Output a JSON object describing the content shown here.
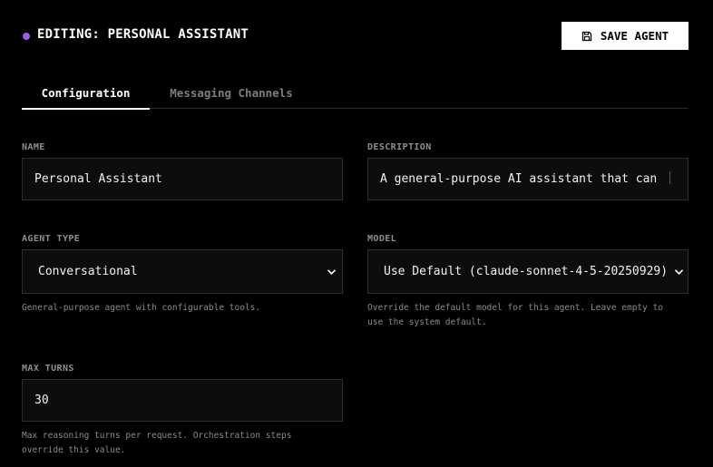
{
  "header": {
    "title": "EDITING: PERSONAL ASSISTANT",
    "save_label": "SAVE AGENT",
    "accent": "#9b5cf0"
  },
  "tabs": [
    {
      "label": "Configuration",
      "active": true
    },
    {
      "label": "Messaging Channels",
      "active": false
    }
  ],
  "form": {
    "name": {
      "label": "NAME",
      "value": "Personal Assistant"
    },
    "description": {
      "label": "DESCRIPTION",
      "value": "A general-purpose AI assistant that can"
    },
    "agent_type": {
      "label": "AGENT TYPE",
      "value": "Conversational",
      "help": "General-purpose agent with configurable tools."
    },
    "model": {
      "label": "MODEL",
      "value": "Use Default (claude-sonnet-4-5-20250929)",
      "help_line1": "Override the default model for this agent. Leave empty to",
      "help_line2": "use the system default."
    },
    "max_turns": {
      "label": "MAX TURNS",
      "value": "30",
      "help_line1": "Max reasoning turns per request. Orchestration steps",
      "help_line2": "override this value."
    }
  },
  "icons": {
    "save": "save-icon",
    "dropdown": "chevron-down-icon"
  }
}
